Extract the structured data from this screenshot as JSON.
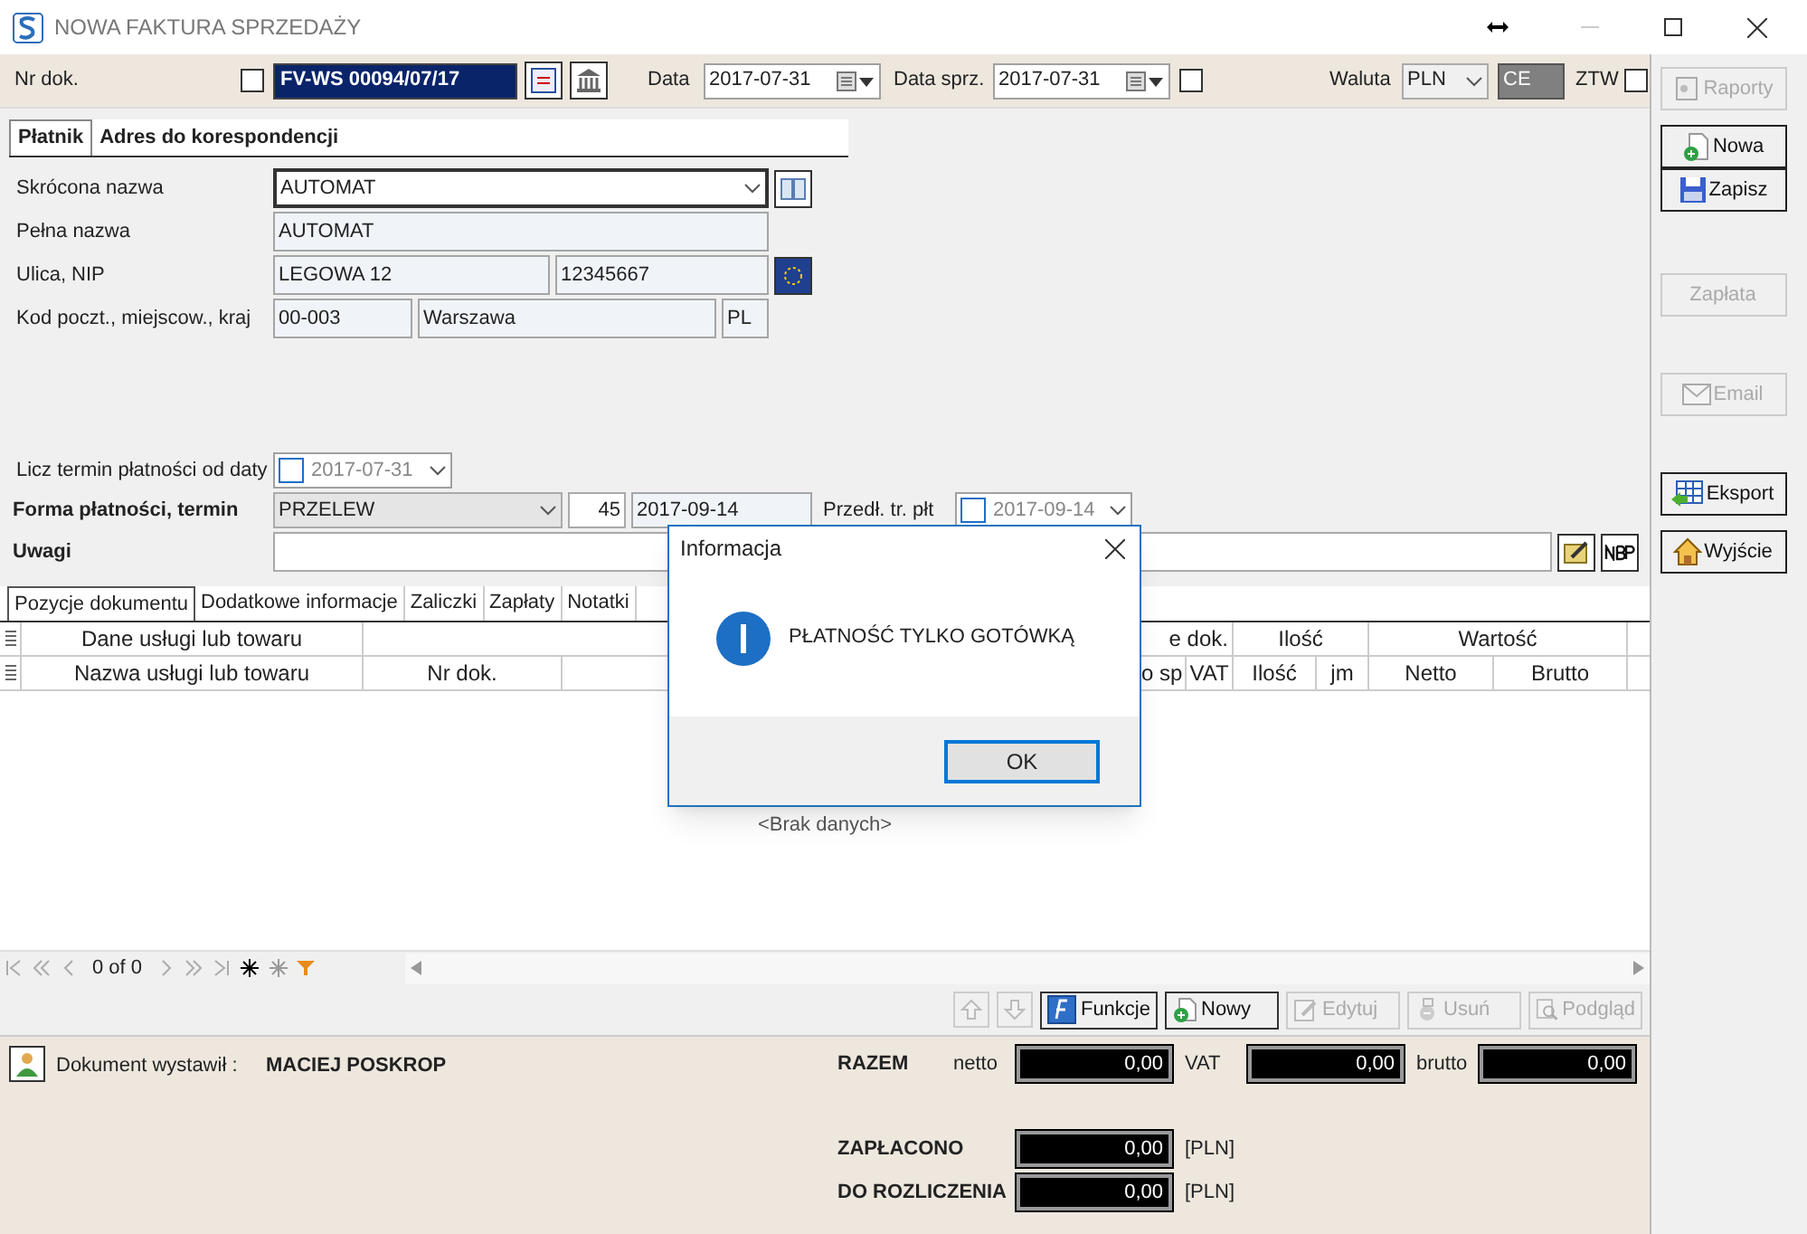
{
  "window": {
    "title": "NOWA FAKTURA SPRZEDAŻY"
  },
  "header": {
    "doc_label": "Nr dok.",
    "doc_checked": false,
    "doc_number": "FV-WS 00094/07/17",
    "date_label": "Data",
    "date": "2017-07-31",
    "sale_date_label": "Data sprz.",
    "sale_date": "2017-07-31",
    "sale_date_checked": false,
    "currency_label": "Waluta",
    "currency": "PLN",
    "currency_code": "CE",
    "ztw_label": "ZTW",
    "ztw_checked": false
  },
  "party_tabs": [
    {
      "label": "Płatnik",
      "selected": true
    },
    {
      "label": "Adres do korespondencji",
      "selected": false
    }
  ],
  "party": {
    "short_name_label": "Skrócona nazwa",
    "short_name": "AUTOMAT",
    "full_name_label": "Pełna nazwa",
    "full_name": "AUTOMAT",
    "street_label": "Ulica, NIP",
    "street": "LEGOWA 12",
    "nip": "12345667",
    "city_label": "Kod poczt., miejscow., kraj",
    "postal_code": "00-003",
    "city": "Warszawa",
    "country": "PL"
  },
  "payment": {
    "term_from_label": "Licz termin płatności od daty",
    "term_from_checked": false,
    "term_from_date": "2017-07-31",
    "method_label": "Forma płatności, termin",
    "method": "PRZELEW",
    "days": "45",
    "due_date": "2017-09-14",
    "extend_label": "Przedł. tr. płt",
    "extend_checked": false,
    "extend_date": "2017-09-14",
    "notes_label": "Uwagi"
  },
  "doc_tabs": [
    {
      "label": "Pozycje dokumentu",
      "selected": true
    },
    {
      "label": "Dodatkowe informacje",
      "selected": false
    },
    {
      "label": "Zaliczki",
      "selected": false
    },
    {
      "label": "Zapłaty",
      "selected": false
    },
    {
      "label": "Notatki",
      "selected": false
    }
  ],
  "table": {
    "group_headers_left": [
      "Dane usługi lub towaru"
    ],
    "group_headers_right": [
      "e dok.",
      "Ilość",
      "Wartość"
    ],
    "columns_left": [
      "Nazwa usługi lub towaru",
      "Nr dok."
    ],
    "columns_right": [
      "o sp",
      "VAT",
      "Ilość",
      "jm",
      "Netto",
      "Brutto"
    ],
    "empty_text": "<Brak danych>"
  },
  "navigator": {
    "position": "0 of 0"
  },
  "actions": [
    {
      "label": "Funkcje",
      "kind": "functions",
      "disabled": false
    },
    {
      "label": "Nowy",
      "kind": "add",
      "disabled": false
    },
    {
      "label": "Edytuj",
      "kind": "edit",
      "disabled": true
    },
    {
      "label": "Usuń",
      "kind": "delete",
      "disabled": true
    },
    {
      "label": "Podgląd",
      "kind": "preview",
      "disabled": true
    }
  ],
  "footer": {
    "issued_by_label": "Dokument wystawił :",
    "issued_by": "MACIEJ POSKROP",
    "total_label": "RAZEM",
    "net_label": "netto",
    "net": "0,00",
    "vat_label": "VAT",
    "vat": "0,00",
    "gross_label": "brutto",
    "gross": "0,00",
    "paid_label": "ZAPŁACONO",
    "paid": "0,00",
    "paid_currency": "[PLN]",
    "due_label": "DO ROZLICZENIA",
    "due": "0,00",
    "due_currency": "[PLN]"
  },
  "side_buttons": [
    {
      "label": "Raporty",
      "kind": "report",
      "disabled": true
    },
    {
      "label": "Nowa",
      "kind": "new",
      "disabled": false
    },
    {
      "label": "Zapisz",
      "kind": "save",
      "disabled": false
    },
    {
      "label": "Zapłata",
      "kind": "none",
      "disabled": true
    },
    {
      "label": "Email",
      "kind": "mail",
      "disabled": true
    },
    {
      "label": "Eksport",
      "kind": "export",
      "disabled": false
    },
    {
      "label": "Wyjście",
      "kind": "exit",
      "disabled": false
    }
  ],
  "dialog": {
    "title": "Informacja",
    "message": "PŁATNOŚĆ TYLKO GOTÓWKĄ",
    "button": "OK"
  }
}
